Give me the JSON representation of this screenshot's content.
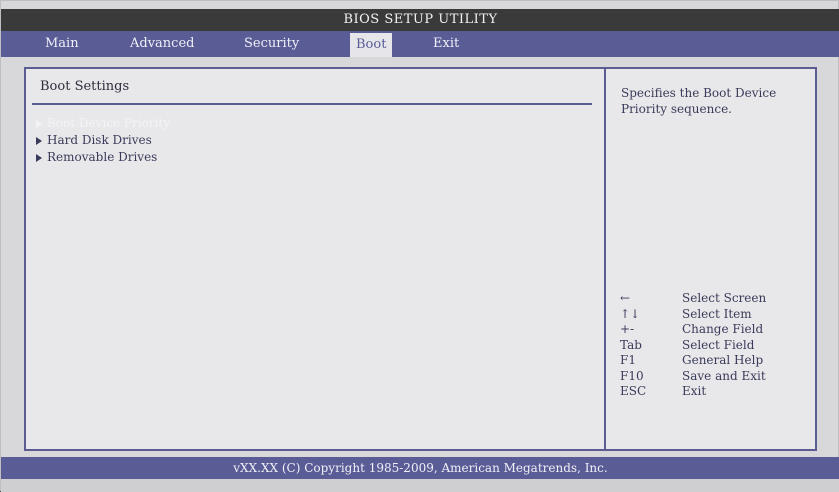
{
  "title": "BIOS SETUP UTILITY",
  "menu": [
    {
      "label": "Main",
      "active": false
    },
    {
      "label": "Advanced",
      "active": false
    },
    {
      "label": "Security",
      "active": false
    },
    {
      "label": "Boot",
      "active": true
    },
    {
      "label": "Exit",
      "active": false
    }
  ],
  "section_title": "Boot Settings",
  "items": [
    {
      "label": "Boot Device Priority",
      "selected": true
    },
    {
      "label": "Hard Disk Drives",
      "selected": false
    },
    {
      "label": "Removable Drives",
      "selected": false
    }
  ],
  "help_text": "Specifies the Boot Device Priority sequence.",
  "keys": [
    {
      "key": "←",
      "desc": "Select Screen"
    },
    {
      "key": "↑↓",
      "desc": "Select Item"
    },
    {
      "key": "+-",
      "desc": "Change Field"
    },
    {
      "key": "Tab",
      "desc": "Select Field"
    },
    {
      "key": "F1",
      "desc": "General Help"
    },
    {
      "key": "F10",
      "desc": "Save and Exit"
    },
    {
      "key": "ESC",
      "desc": "Exit"
    }
  ],
  "footer": "vXX.XX (C) Copyright 1985-2009, American Megatrends, Inc."
}
